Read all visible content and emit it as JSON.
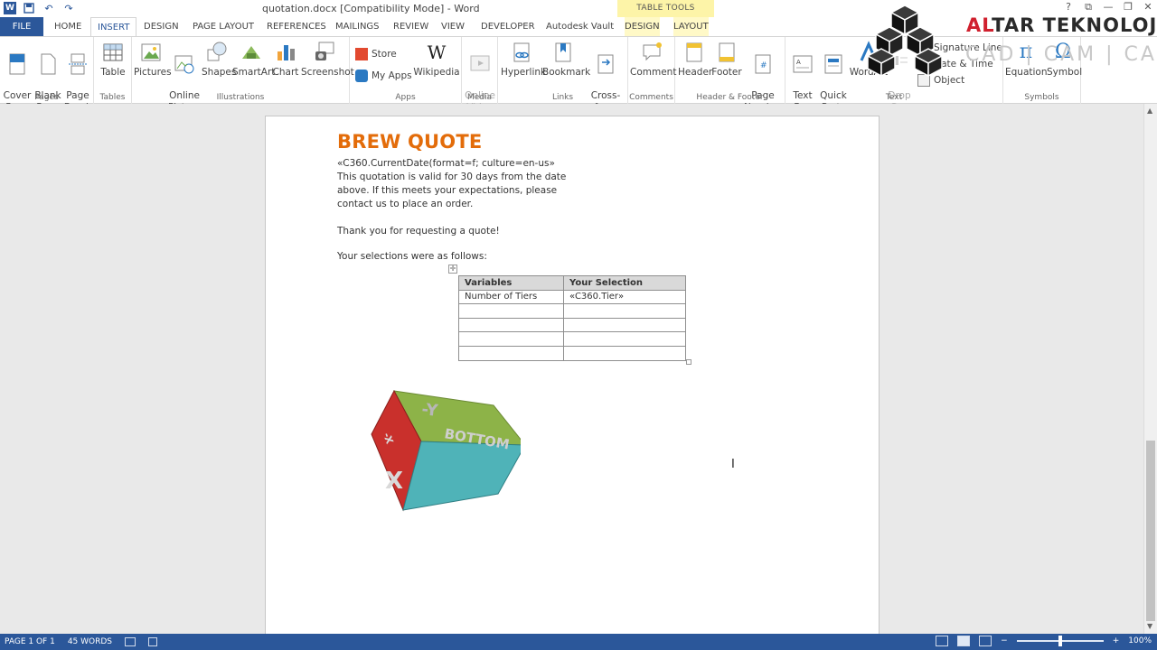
{
  "titlebar": {
    "title": "quotation.docx [Compatibility Mode] - Word",
    "window_buttons": [
      "?",
      "⧉",
      "—",
      "❐",
      "✕"
    ],
    "undo_label": "↶",
    "redo_label": "↷"
  },
  "context_tab": {
    "header": "TABLE TOOLS",
    "tabs": [
      "DESIGN",
      "LAYOUT"
    ]
  },
  "tabs": [
    "FILE",
    "HOME",
    "INSERT",
    "DESIGN",
    "PAGE LAYOUT",
    "REFERENCES",
    "MAILINGS",
    "REVIEW",
    "VIEW",
    "DEVELOPER",
    "Autodesk Vault"
  ],
  "ribbon": {
    "pages": {
      "label": "Pages",
      "cover_page": "Cover\nPage",
      "blank_page": "Blank\nPage",
      "page_break": "Page\nBreak"
    },
    "tables": {
      "label": "Tables",
      "table": "Table"
    },
    "illustrations": {
      "label": "Illustrations",
      "pictures": "Pictures",
      "online_pictures": "Online\nPictures",
      "shapes": "Shapes",
      "smartart": "SmartArt",
      "chart": "Chart",
      "screenshot": "Screenshot"
    },
    "apps": {
      "label": "Apps",
      "store": "Store",
      "my_apps": "My Apps",
      "wikipedia": "Wikipedia"
    },
    "media": {
      "label": "Media",
      "online_video": "Online\nVideo"
    },
    "links": {
      "label": "Links",
      "hyperlink": "Hyperlink",
      "bookmark": "Bookmark",
      "cross_reference": "Cross-\nreference"
    },
    "comments": {
      "label": "Comments",
      "comment": "Comment"
    },
    "header_footer": {
      "label": "Header & Footer",
      "header": "Header",
      "footer": "Footer",
      "page_number": "Page\nNumber"
    },
    "text": {
      "label": "Text",
      "text_box": "Text\nBox",
      "quick_parts": "Quick\nParts",
      "wordart": "WordArt",
      "drop_cap": "Drop\nCap",
      "signature_line": "Signature Line",
      "date_time": "Date & Time",
      "object": "Object"
    },
    "symbols": {
      "label": "Symbols",
      "equation": "Equation",
      "symbol": "Symbol"
    }
  },
  "logo": {
    "highlight": "AL",
    "rest": "TAR TEKNOLOJİ",
    "sub": "CAD | CAM | CAE"
  },
  "document": {
    "heading": "BREW QUOTE",
    "lines": [
      "«C360.CurrentDate(format=f; culture=en-us»",
      "This quotation is valid for 30 days from the date",
      "above.  If this meets your expectations, please",
      "contact us to place an order."
    ],
    "thanks": "Thank you for requesting a quote!",
    "selections_intro": "Your selections were as follows:",
    "table": {
      "headers": [
        "Variables",
        "Your Selection"
      ],
      "rows": [
        [
          "Number of Tiers",
          "«C360.Tier»"
        ],
        [
          "",
          ""
        ],
        [
          "",
          ""
        ],
        [
          "",
          ""
        ],
        [
          "",
          ""
        ]
      ]
    },
    "cube_faces": [
      "-Y",
      "BOTTOM",
      "X",
      "-X"
    ]
  },
  "status": {
    "page": "PAGE 1 OF 1",
    "words": "45 WORDS",
    "zoom": "100%"
  },
  "colors": {
    "word_blue": "#2b579a",
    "heading_orange": "#e36c0a",
    "logo_red": "#d0202e"
  }
}
